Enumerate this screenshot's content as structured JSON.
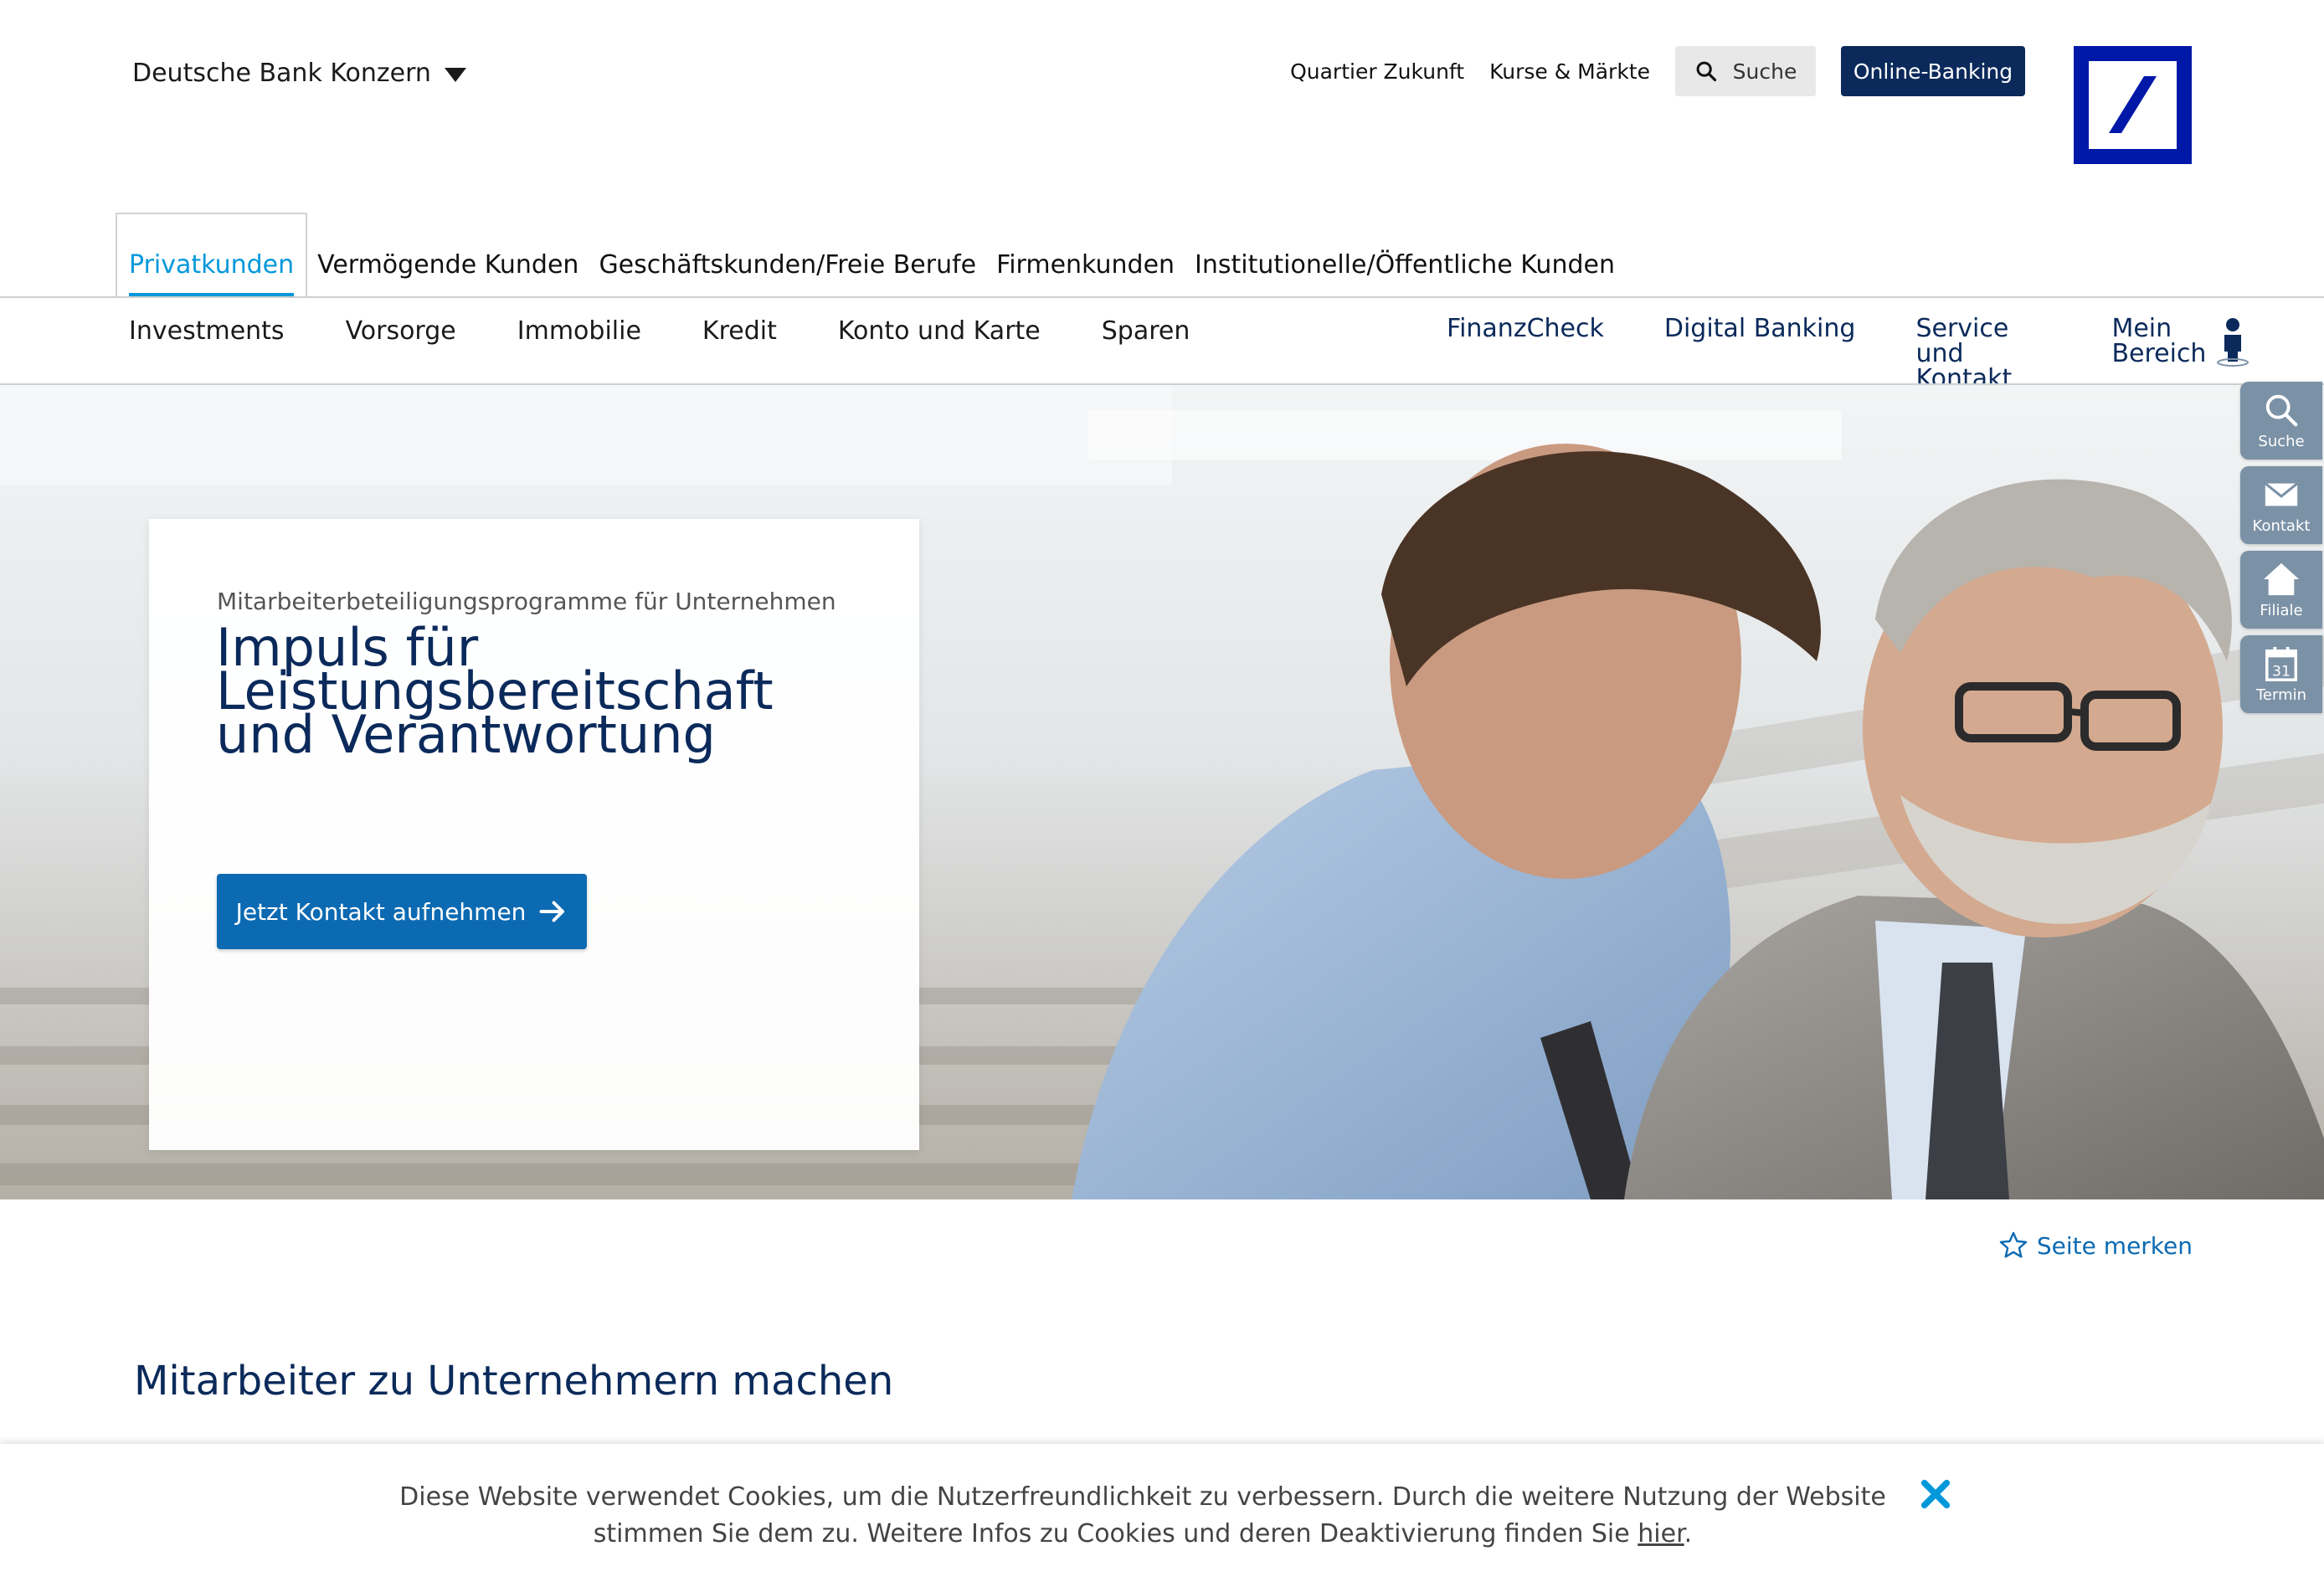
{
  "header": {
    "konzern_label": "Deutsche Bank Konzern",
    "utility_links": [
      "Quartier Zukunft",
      "Kurse & Märkte"
    ],
    "search_label": "Suche",
    "online_banking_label": "Online-Banking",
    "logo_icon": "deutsche-bank-logo",
    "logo_color": "#0018a8"
  },
  "segments": [
    {
      "label": "Privatkunden",
      "active": true
    },
    {
      "label": "Vermögende Kunden"
    },
    {
      "label": "Geschäftskunden/Freie Berufe"
    },
    {
      "label": "Firmenkunden"
    },
    {
      "label": "Institutionelle/Öffentliche Kunden"
    }
  ],
  "mainnav": [
    "Investments",
    "Vorsorge",
    "Immobilie",
    "Kredit",
    "Konto und Karte",
    "Sparen"
  ],
  "rightnav": {
    "finanzcheck": "FinanzCheck",
    "digital_banking": "Digital Banking",
    "service_1": "Service",
    "service_2": "und Kontakt",
    "mein_1": "Mein",
    "mein_2": "Bereich"
  },
  "hero": {
    "kicker": "Mitarbeiterbeteiligungsprogramme für Unternehmen",
    "title_lines": [
      "Impuls für",
      "Leistungsbereitschaft",
      "und Verantwortung"
    ],
    "cta_label": "Jetzt Kontakt aufnehmen"
  },
  "sidetools": [
    "Suche",
    "Kontakt",
    "Filiale",
    "Termin"
  ],
  "termin_day": "31",
  "merken_label": "Seite merken",
  "section_title": "Mitarbeiter zu Unternehmern machen",
  "cookie": {
    "text_1": "Diese Website verwendet Cookies, um die Nutzerfreundlichkeit zu verbessern. Durch die weitere Nutzung der Website stimmen Sie dem zu. Weitere Infos zu Cookies und deren Deaktivierung finden Sie ",
    "link": "hier",
    "text_2": "."
  },
  "colors": {
    "brand_blue": "#0018a8",
    "navy": "#0b2a5b",
    "accent": "#0098db",
    "cta": "#0c6ab2",
    "sidetool": "#7b91a6"
  }
}
